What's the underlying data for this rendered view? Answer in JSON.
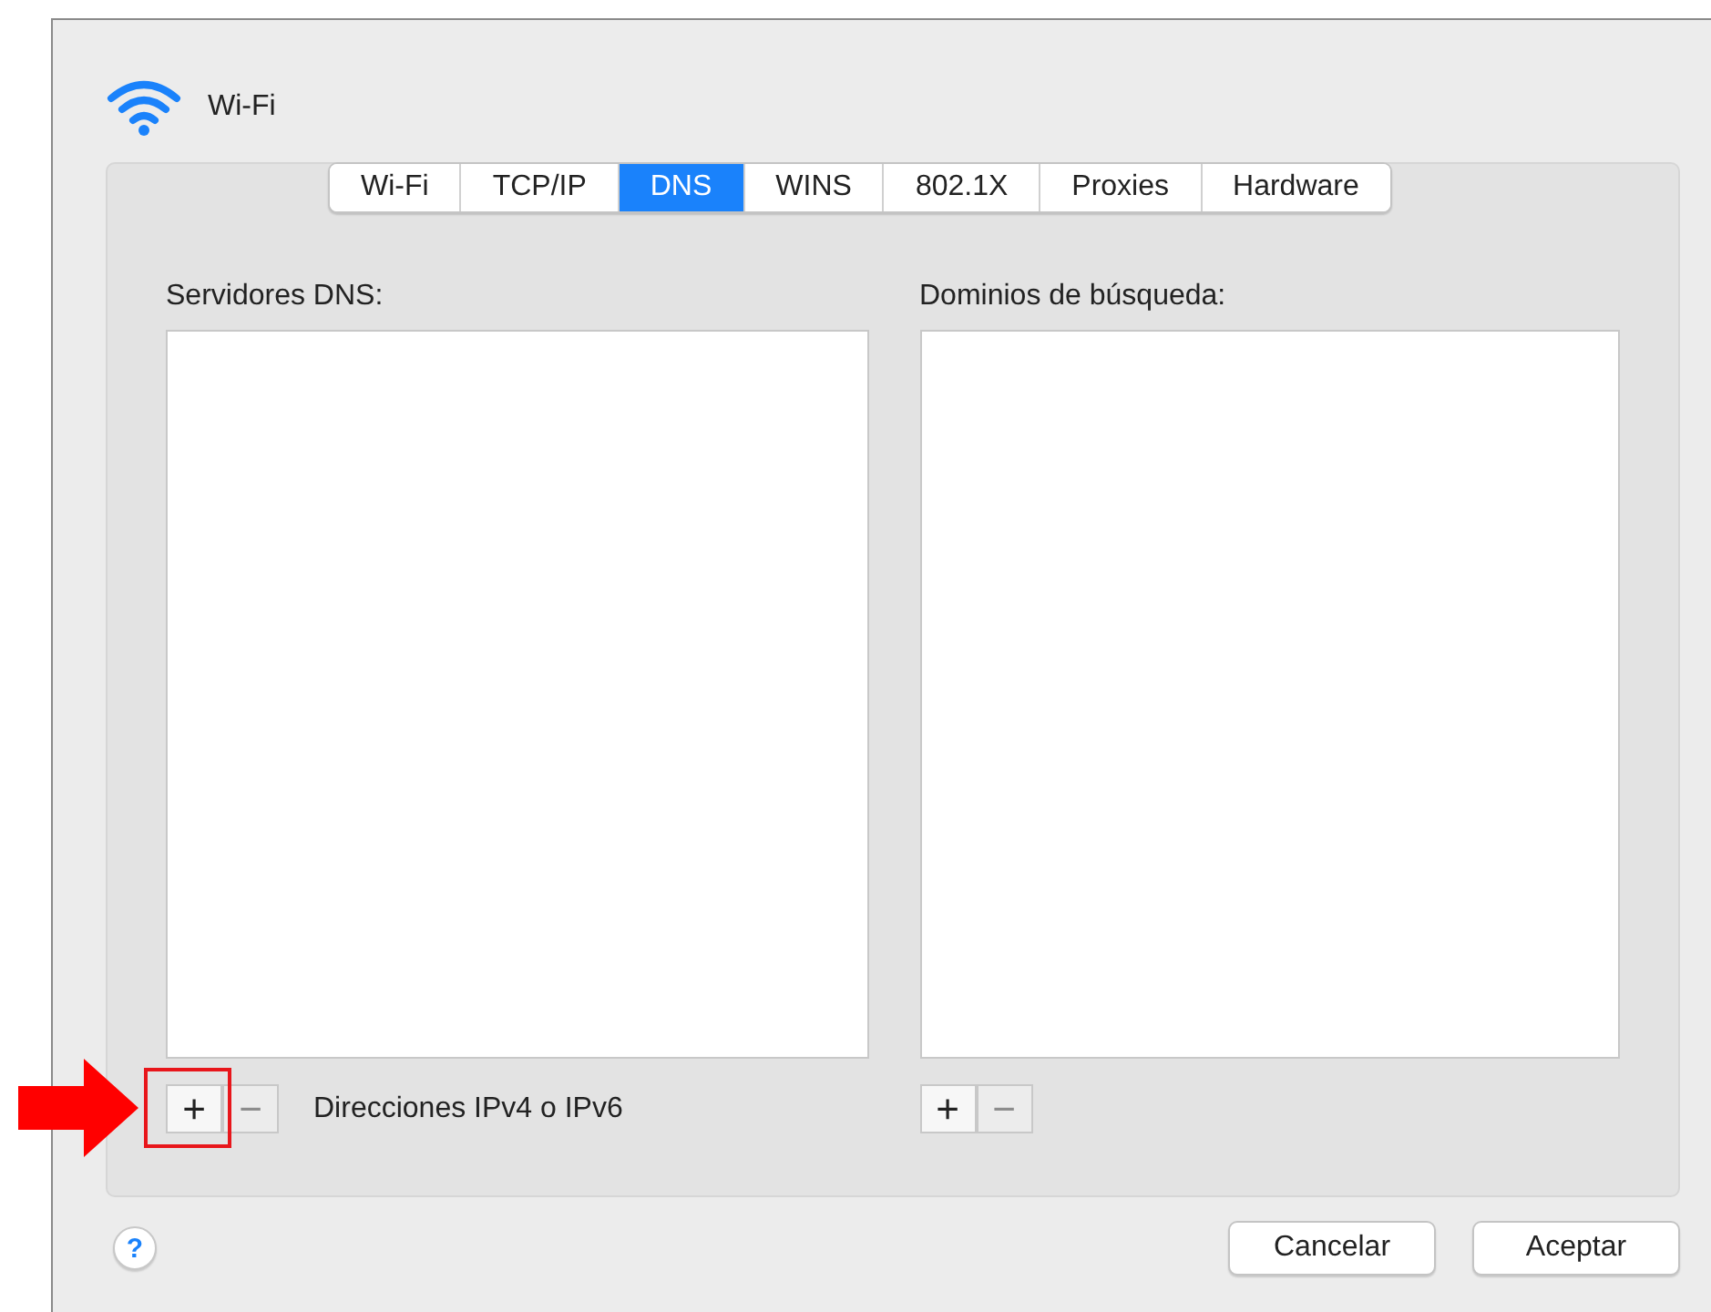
{
  "window": {
    "title": "Wi-Fi"
  },
  "tabs": [
    {
      "label": "Wi-Fi",
      "selected": false
    },
    {
      "label": "TCP/IP",
      "selected": false
    },
    {
      "label": "DNS",
      "selected": true
    },
    {
      "label": "WINS",
      "selected": false
    },
    {
      "label": "802.1X",
      "selected": false
    },
    {
      "label": "Proxies",
      "selected": false
    },
    {
      "label": "Hardware",
      "selected": false
    }
  ],
  "lists": [
    {
      "label": "Servidores DNS:",
      "add": {
        "label": "+",
        "disabled": false,
        "highlighted": true
      },
      "remove": {
        "label": "−",
        "disabled": true
      },
      "hint": "Direcciones IPv4 o IPv6"
    },
    {
      "label": "Dominios de búsqueda:",
      "add": {
        "label": "+",
        "disabled": false
      },
      "remove": {
        "label": "−",
        "disabled": true
      }
    }
  ],
  "help": {
    "label": "?"
  },
  "buttons": [
    {
      "label": "Cancelar"
    },
    {
      "label": "Aceptar"
    }
  ]
}
